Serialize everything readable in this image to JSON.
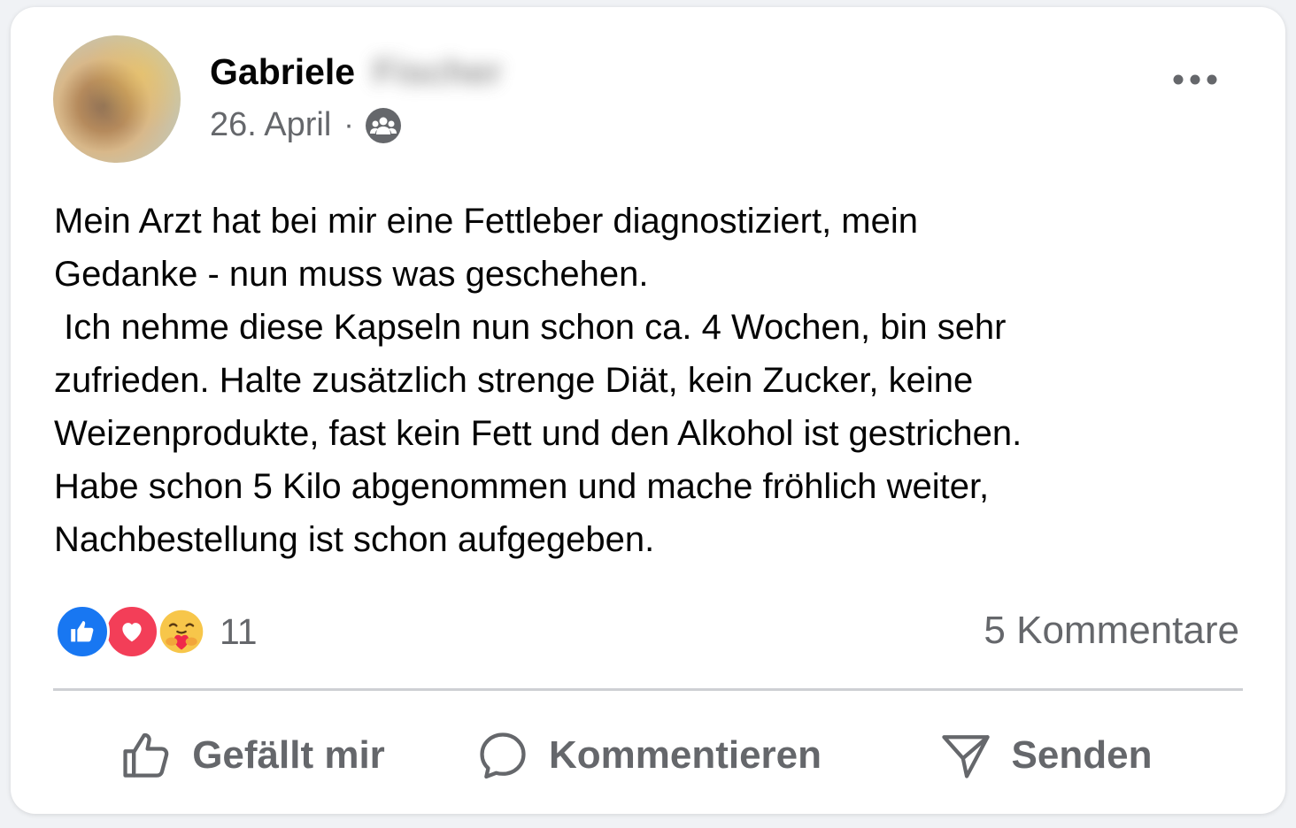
{
  "post": {
    "author_first_name": "Gabriele",
    "author_last_name_blurred": "Fischer",
    "date": "26. April",
    "separator": "·",
    "audience_icon": "group-icon",
    "text": "Mein Arzt hat bei mir eine Fettleber diagnostiziert, mein\nGedanke - nun muss was geschehen.\n Ich nehme diese Kapseln nun schon ca. 4 Wochen, bin sehr\nzufrieden. Halte zusätzlich strenge Diät, kein Zucker, keine\nWeizenprodukte, fast kein Fett und den Alkohol ist gestrichen.\nHabe schon 5 Kilo abgenommen und mache fröhlich weiter,\nNachbestellung ist schon aufgegeben."
  },
  "stats": {
    "reactions": [
      "like",
      "love",
      "care"
    ],
    "reaction_count": "11",
    "comments": "5 Kommentare"
  },
  "actions": {
    "like_label": "Gefällt mir",
    "comment_label": "Kommentieren",
    "send_label": "Senden"
  },
  "colors": {
    "like_blue": "#1877f2",
    "love_red": "#f33e58",
    "secondary_text": "#65676b"
  }
}
